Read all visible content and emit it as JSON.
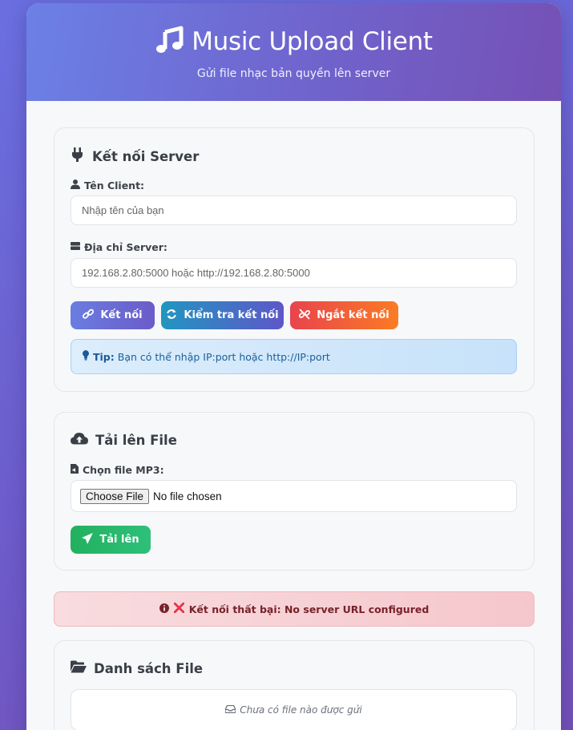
{
  "header": {
    "title": "Music Upload Client",
    "subtitle": "Gửi file nhạc bản quyền lên server"
  },
  "connection": {
    "title": "Kết nối Server",
    "client_label": "Tên Client:",
    "client_placeholder": "Nhập tên của bạn",
    "server_label": "Địa chỉ Server:",
    "server_placeholder": "192.168.2.80:5000 hoặc http://192.168.2.80:5000",
    "connect_label": "Kết nối",
    "check_label": "Kiểm tra kết nối",
    "disconnect_label": "Ngắt kết nối",
    "tip_bold": "Tip:",
    "tip_text": "Bạn có thể nhập IP:port hoặc http://IP:port"
  },
  "upload": {
    "title": "Tải lên File",
    "file_label": "Chọn file MP3:",
    "choose_file_label": "Choose File",
    "no_file_text": "No file chosen",
    "upload_label": "Tải lên"
  },
  "alert": {
    "text": "Kết nối thất bại: No server URL configured"
  },
  "files": {
    "title": "Danh sách File",
    "empty_text": "Chưa có file nào được gửi"
  },
  "icons": [
    "music-icon",
    "plug-icon",
    "user-icon",
    "server-icon",
    "link-icon",
    "sync-icon",
    "unlink-icon",
    "lightbulb-icon",
    "cloud-upload-icon",
    "file-audio-icon",
    "paper-plane-icon",
    "info-icon",
    "x-icon",
    "folder-open-icon",
    "inbox-icon"
  ],
  "colors": {
    "connect_button": "#6b6fdc",
    "check_button": "#2a8fc2",
    "disconnect_button": "#f0483f",
    "upload_button": "#22b163",
    "alert_text": "#772229",
    "tip_text": "#1c5f9a"
  }
}
